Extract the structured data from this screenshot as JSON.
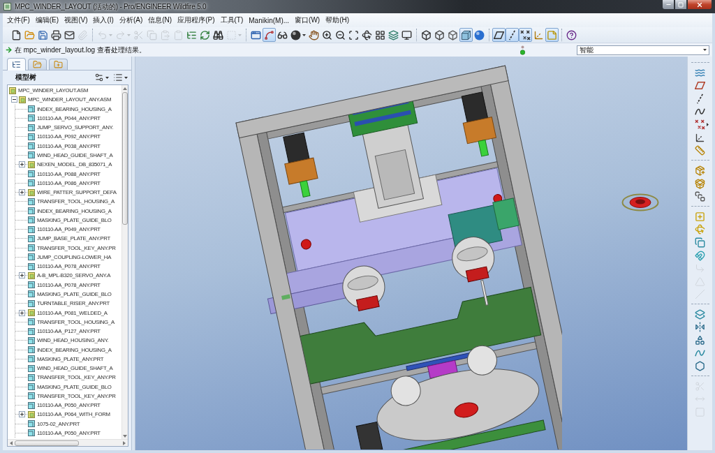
{
  "window": {
    "title": "MPC_WINDER_LAYOUT (活动的) - Pro/ENGINEER Wildfire 5.0"
  },
  "menu": [
    "文件(F)",
    "编辑(E)",
    "视图(V)",
    "插入(I)",
    "分析(A)",
    "信息(N)",
    "应用程序(P)",
    "工具(T)",
    "Manikin(M)...",
    "窗口(W)",
    "帮助(H)"
  ],
  "toolbar": [
    [
      {
        "kind": "new",
        "on": false,
        "disabled": false,
        "dropdown": false
      },
      {
        "kind": "open",
        "on": false,
        "disabled": false,
        "dropdown": false
      },
      {
        "kind": "save",
        "on": false,
        "disabled": false,
        "dropdown": false
      },
      {
        "kind": "print",
        "on": false,
        "disabled": false,
        "dropdown": false
      },
      {
        "kind": "mail",
        "on": false,
        "disabled": false,
        "dropdown": false
      },
      {
        "kind": "mailzip",
        "on": false,
        "disabled": true,
        "dropdown": false
      }
    ],
    [
      {
        "kind": "undo",
        "on": false,
        "disabled": true,
        "dropdown": true
      },
      {
        "kind": "redo",
        "on": false,
        "disabled": true,
        "dropdown": true
      },
      {
        "kind": "cut",
        "on": false,
        "disabled": true,
        "dropdown": false
      },
      {
        "kind": "copy",
        "on": false,
        "disabled": true,
        "dropdown": false
      },
      {
        "kind": "paste",
        "on": false,
        "disabled": true,
        "dropdown": false
      },
      {
        "kind": "pastespecial",
        "on": false,
        "disabled": true,
        "dropdown": false
      },
      {
        "kind": "regenerate",
        "on": false,
        "disabled": false,
        "dropdown": false
      },
      {
        "kind": "regenmanager",
        "on": false,
        "disabled": false,
        "dropdown": false
      },
      {
        "kind": "find",
        "on": false,
        "disabled": false,
        "dropdown": false
      },
      {
        "kind": "select",
        "on": false,
        "disabled": true,
        "dropdown": true
      }
    ],
    [
      {
        "kind": "repaint",
        "on": false,
        "disabled": false,
        "dropdown": false
      },
      {
        "kind": "spin",
        "on": true,
        "disabled": false,
        "dropdown": false
      },
      {
        "kind": "views",
        "on": false,
        "disabled": false,
        "dropdown": false
      },
      {
        "kind": "appearance",
        "on": false,
        "disabled": false,
        "dropdown": true
      },
      {
        "kind": "orient",
        "on": false,
        "disabled": false,
        "dropdown": false
      },
      {
        "kind": "zoomin",
        "on": false,
        "disabled": false,
        "dropdown": false
      },
      {
        "kind": "zoomout",
        "on": false,
        "disabled": false,
        "dropdown": false
      },
      {
        "kind": "refit",
        "on": false,
        "disabled": false,
        "dropdown": false
      },
      {
        "kind": "reorient",
        "on": false,
        "disabled": false,
        "dropdown": false
      },
      {
        "kind": "savedviews",
        "on": false,
        "disabled": false,
        "dropdown": false
      },
      {
        "kind": "layers",
        "on": false,
        "disabled": false,
        "dropdown": false
      },
      {
        "kind": "setup",
        "on": false,
        "disabled": false,
        "dropdown": false
      }
    ],
    [
      {
        "kind": "wireframe",
        "on": false,
        "disabled": false,
        "dropdown": false
      },
      {
        "kind": "hiddenline",
        "on": false,
        "disabled": false,
        "dropdown": false
      },
      {
        "kind": "nohidden",
        "on": false,
        "disabled": false,
        "dropdown": false
      },
      {
        "kind": "shaded",
        "on": true,
        "disabled": false,
        "dropdown": false
      },
      {
        "kind": "realism",
        "on": false,
        "disabled": false,
        "dropdown": false
      }
    ],
    [
      {
        "kind": "planes",
        "on": true,
        "disabled": false,
        "dropdown": false
      },
      {
        "kind": "axes",
        "on": true,
        "disabled": false,
        "dropdown": false
      },
      {
        "kind": "points",
        "on": true,
        "disabled": false,
        "dropdown": false
      },
      {
        "kind": "csys",
        "on": false,
        "disabled": false,
        "dropdown": false
      },
      {
        "kind": "annotations",
        "on": true,
        "disabled": false,
        "dropdown": false
      }
    ],
    [
      {
        "kind": "help",
        "on": false,
        "disabled": false,
        "dropdown": false
      }
    ]
  ],
  "message": {
    "text": "在 mpc_winder_layout.log 查看处理结果。"
  },
  "filter": {
    "value": "智能"
  },
  "navigator": {
    "tabs": [
      {
        "kind": "tree",
        "selected": true
      },
      {
        "kind": "folders",
        "selected": false
      },
      {
        "kind": "favorites",
        "selected": false
      }
    ],
    "title": "模型树"
  },
  "model_tree": {
    "label": "MPC_WINDER_LAYOUT.ASM",
    "kind": "assembly",
    "children": [
      {
        "label": "MPC_WINDER_LAYOUT_ANY.ASM",
        "kind": "assembly",
        "expanded": true,
        "children": [
          {
            "label": "INDEX_BEARING_HOUSING_A",
            "kind": "part"
          },
          {
            "label": "110110-AA_P044_ANY.PRT",
            "kind": "part"
          },
          {
            "label": "JUMP_SERVO_SUPPORT_ANY.",
            "kind": "part"
          },
          {
            "label": "110110-AA_P092_ANY.PRT",
            "kind": "part"
          },
          {
            "label": "110110-AA_P038_ANY.PRT",
            "kind": "part"
          },
          {
            "label": "WIND_HEAD_GUIDE_SHAFT_A",
            "kind": "part"
          },
          {
            "label": "NEXEN_MODEL_DB_835071_A",
            "kind": "assembly",
            "expanded": false
          },
          {
            "label": "110110-AA_P088_ANY.PRT",
            "kind": "part"
          },
          {
            "label": "110110-AA_P086_ANY.PRT",
            "kind": "part"
          },
          {
            "label": "WIRE_PATTER_SUPPORT_DEFA",
            "kind": "assembly",
            "expanded": false
          },
          {
            "label": "TRANSFER_TOOL_HOUSING_A",
            "kind": "part"
          },
          {
            "label": "INDEX_BEARING_HOUSING_A",
            "kind": "part"
          },
          {
            "label": "MASKING_PLATE_GUIDE_BLO",
            "kind": "part"
          },
          {
            "label": "110110-AA_P049_ANY.PRT",
            "kind": "part"
          },
          {
            "label": "JUMP_BASE_PLATE_ANY.PRT",
            "kind": "part"
          },
          {
            "label": "TRANSFER_TOOL_KEY_ANY.PR",
            "kind": "part"
          },
          {
            "label": "JUMP_COUPLING-LOWER_HA",
            "kind": "part"
          },
          {
            "label": "110110-AA_P078_ANY.PRT",
            "kind": "part"
          },
          {
            "label": "A-B_MPL-B320_SERVO_ANY.A",
            "kind": "assembly",
            "expanded": false
          },
          {
            "label": "110110-AA_P078_ANY.PRT",
            "kind": "part"
          },
          {
            "label": "MASKING_PLATE_GUIDE_BLO",
            "kind": "part"
          },
          {
            "label": "TURNTABLE_RISER_ANY.PRT",
            "kind": "part"
          },
          {
            "label": "110110-AA_P081_WELDED_A",
            "kind": "assembly",
            "expanded": false
          },
          {
            "label": "TRANSFER_TOOL_HOUSING_A",
            "kind": "part"
          },
          {
            "label": "110110-AA_P127_ANY.PRT",
            "kind": "part"
          },
          {
            "label": "WIND_HEAD_HOUSING_ANY.",
            "kind": "part"
          },
          {
            "label": "INDEX_BEARING_HOUSING_A",
            "kind": "part"
          },
          {
            "label": "MASKING_PLATE_ANY.PRT",
            "kind": "part"
          },
          {
            "label": "WIND_HEAD_GUIDE_SHAFT_A",
            "kind": "part"
          },
          {
            "label": "TRANSFER_TOOL_KEY_ANY.PR",
            "kind": "part"
          },
          {
            "label": "MASKING_PLATE_GUIDE_BLO",
            "kind": "part"
          },
          {
            "label": "TRANSFER_TOOL_KEY_ANY.PR",
            "kind": "part"
          },
          {
            "label": "110110-AA_P050_ANY.PRT",
            "kind": "part"
          },
          {
            "label": "110110-AA_P064_WITH_FORM",
            "kind": "assembly",
            "expanded": false
          },
          {
            "label": "1075-02_ANY.PRT",
            "kind": "part"
          },
          {
            "label": "110110-AA_P050_ANY.PRT",
            "kind": "part"
          }
        ]
      }
    ]
  },
  "right_toolbar": [
    [
      {
        "kind": "sketch",
        "disabled": false,
        "dropdown": false
      },
      {
        "kind": "plane",
        "disabled": false,
        "dropdown": false
      },
      {
        "kind": "axis",
        "disabled": false,
        "dropdown": false
      },
      {
        "kind": "curve",
        "disabled": false,
        "dropdown": false
      },
      {
        "kind": "point",
        "disabled": false,
        "dropdown": true
      },
      {
        "kind": "csys",
        "disabled": false,
        "dropdown": false
      },
      {
        "kind": "analysis",
        "disabled": false,
        "dropdown": false
      }
    ],
    [
      {
        "kind": "assemble",
        "disabled": false,
        "dropdown": false
      },
      {
        "kind": "create",
        "disabled": false,
        "dropdown": false
      },
      {
        "kind": "package",
        "disabled": false,
        "dropdown": false
      }
    ],
    [
      {
        "kind": "extrude",
        "disabled": false,
        "dropdown": false
      },
      {
        "kind": "revolve",
        "disabled": false,
        "dropdown": false
      },
      {
        "kind": "merge",
        "disabled": false,
        "dropdown": false
      },
      {
        "kind": "channel",
        "disabled": false,
        "dropdown": false
      },
      {
        "kind": "round",
        "disabled": true,
        "dropdown": false
      },
      {
        "kind": "chamfer",
        "disabled": true,
        "dropdown": false
      },
      {
        "kind": "draft",
        "disabled": true,
        "dropdown": false
      }
    ],
    [
      {
        "kind": "copy",
        "disabled": false,
        "dropdown": false
      },
      {
        "kind": "mirror",
        "disabled": false,
        "dropdown": false
      },
      {
        "kind": "warp",
        "disabled": false,
        "dropdown": false
      },
      {
        "kind": "surface",
        "disabled": false,
        "dropdown": false
      },
      {
        "kind": "boundary",
        "disabled": false,
        "dropdown": false
      }
    ],
    [
      {
        "kind": "trim",
        "disabled": true,
        "dropdown": false
      },
      {
        "kind": "extend",
        "disabled": true,
        "dropdown": false
      },
      {
        "kind": "offset",
        "disabled": true,
        "dropdown": false
      }
    ]
  ]
}
